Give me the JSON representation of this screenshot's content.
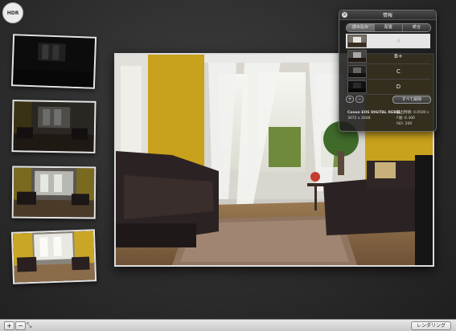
{
  "app": {
    "logo_text": "HDR"
  },
  "info_panel": {
    "title": "情報",
    "tabs": [
      "読み込み",
      "配置",
      "統合"
    ],
    "active_tab": 0,
    "variants": [
      {
        "label": "A",
        "selected": true
      },
      {
        "label": "B+",
        "selected": false
      },
      {
        "label": "C",
        "selected": false
      },
      {
        "label": "D",
        "selected": false
      }
    ],
    "plus_label": "+",
    "minus_label": "−",
    "select_all_label": "すべて削除",
    "camera": "Canon EOS DIGITAL REBEL",
    "resolution": "3072 x 2048",
    "exposure": "露出時間: 0.0500 s",
    "fnumber": "F値: 6.300",
    "iso": "ISO: 200"
  },
  "bottom_bar": {
    "add_label": "+",
    "remove_label": "−",
    "render_label": "レンダリング"
  },
  "colors": {
    "wall": "#c8a11d",
    "sofa": "#2b2323",
    "floor": "#8a6a47"
  }
}
